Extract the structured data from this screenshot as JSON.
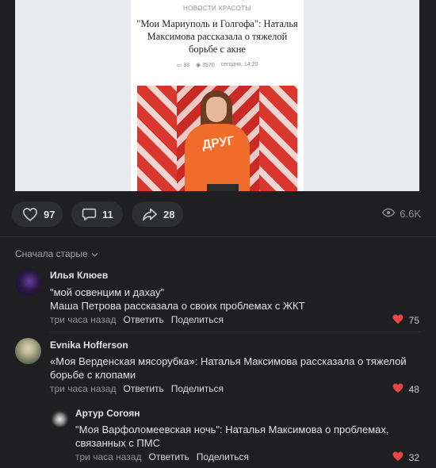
{
  "article": {
    "category": "НОВОСТИ КРАСОТЫ",
    "title": "\"Мои Мариуполь и Голгофа\": Наталья Максимова рассказала о тяжелой борьбе с акне",
    "comments_count": "33",
    "views_count": "3570",
    "date": "сегодня, 14:20"
  },
  "actions": {
    "likes": "97",
    "comments": "11",
    "shares": "28",
    "views": "6.6K"
  },
  "comments_section": {
    "sort_label": "Сначала старые"
  },
  "comments": [
    {
      "author": "Илья Клюев",
      "text_line1": "\"мой освенцим и дахау\"",
      "text_line2": "Маша Петрова рассказала о своих проблемах с ЖКТ",
      "time": "три часа назад",
      "reply": "Ответить",
      "share": "Поделиться",
      "likes": "75"
    },
    {
      "author": "Evnika Hofferson",
      "text": "«Моя Верденская мясорубка»: Наталья Максимова рассказала о тяжелой борьбе с клопами",
      "time": "три часа назад",
      "reply": "Ответить",
      "share": "Поделиться",
      "likes": "48"
    },
    {
      "author": "Артур Согоян",
      "text": "\"Моя Варфоломеевская ночь\": Наталья Максимова о проблемах, связанных с ПМС",
      "time": "три часа назад",
      "reply": "Ответить",
      "share": "Поделиться",
      "likes": "32"
    }
  ],
  "colors": {
    "background": "#1f1f21",
    "pill": "#2d2e30",
    "like_heart": "#e64646",
    "muted_text": "#8d9299"
  },
  "icons": [
    "heart-icon",
    "comment-icon",
    "share-icon",
    "eye-icon",
    "chevron-down-icon"
  ]
}
